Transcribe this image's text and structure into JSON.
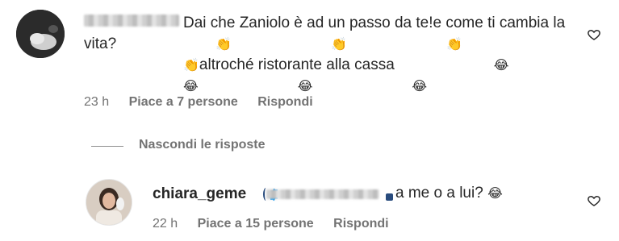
{
  "comment": {
    "text": "Dai che Zaniolo è ad un passo da te!e come ti cambia la vita?",
    "text_after_emojis": "altroché ristorante alla cassa",
    "emoji_clap": "👏",
    "emoji_laugh": "😂",
    "time": "23 h",
    "likes": "Piace a 7 persone",
    "reply": "Rispondi"
  },
  "replies_toggle": "Nascondi le risposte",
  "reply": {
    "username": "chiara_geme",
    "text": "a me o a lui?",
    "emoji": "😂",
    "time": "22 h",
    "likes": "Piace a 15 persone",
    "reply": "Rispondi"
  },
  "colors": {
    "verified": "#0095f6",
    "secondary_text": "#737373"
  }
}
